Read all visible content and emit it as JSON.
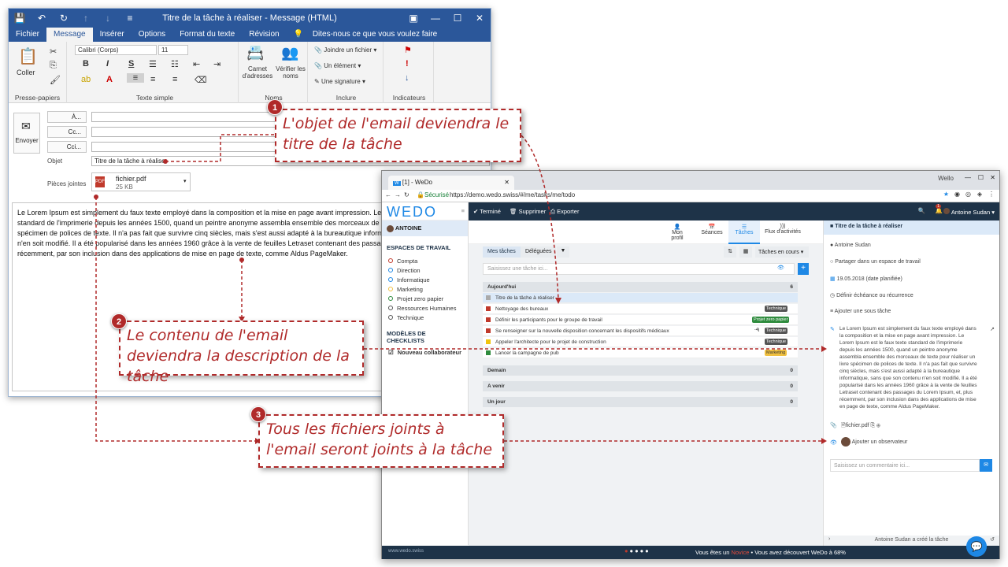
{
  "outlook": {
    "title": "Titre de la tâche à réaliser - Message (HTML)",
    "tabs": [
      "Fichier",
      "Message",
      "Insérer",
      "Options",
      "Format du texte",
      "Révision"
    ],
    "tell_me": "Dites-nous ce que vous voulez faire",
    "paste": "Coller",
    "clipboard": "Presse-papiers",
    "font": "Calibri (Corps)",
    "font_size": "11",
    "simple_text": "Texte simple",
    "address_book": "Carnet d'adresses",
    "check_names": "Vérifier les noms",
    "names": "Noms",
    "attach_file": "Joindre un fichier",
    "item": "Un élément",
    "signature": "Une signature",
    "include": "Inclure",
    "indicators": "Indicateurs",
    "send": "Envoyer",
    "to": "À...",
    "cc": "Cc...",
    "bcc": "Cci...",
    "subject_label": "Objet",
    "subject": "Titre de la tâche à réaliser",
    "attachments_label": "Pièces jointes",
    "attachment_name": "fichier.pdf",
    "attachment_size": "25 KB",
    "body": "Le Lorem Ipsum est simplement du faux texte employé dans la composition et la mise en page avant impression. Le Lorem Ipsum est le faux texte standard de l'imprimerie depuis les années 1500, quand un peintre anonyme assembla ensemble des morceaux de texte pour réaliser un livre spécimen de polices de texte. Il n'a pas fait que survivre cinq siècles, mais s'est aussi adapté à la bureautique informatique, sans que son contenu n'en soit modifié. Il a été popularisé dans les années 1960 grâce à la vente de feuilles Letraset contenant des passages du Lorem Ipsum, et, plus récemment, par son inclusion dans des applications de mise en page de texte, comme Aldus PageMaker."
  },
  "wedo": {
    "tab_title": "[1] - WeDo",
    "window_label": "Wello",
    "secure": "Sécurisé",
    "url": "https://demo.wedo.swiss/#/me/tasks/me/todo",
    "logo": "WEDO",
    "user": "ANTOINE",
    "toolbar": [
      "Terminé",
      "Supprimer",
      "Exporter"
    ],
    "top_user": "Antoine Sudan",
    "notif_count": "1",
    "nav": [
      "Mon profil",
      "Séances",
      "Tâches",
      "Flux d'activités"
    ],
    "spaces_title": "ESPACES DE TRAVAIL",
    "spaces": [
      "Compta",
      "Direction",
      "Informatique",
      "Marketing",
      "Projet zero papier",
      "Ressources Humaines",
      "Technique"
    ],
    "checklists_title": "MODÈLES DE CHECKLISTS",
    "checklist_item": "Nouveau collaborateur",
    "filter_my": "Mes tâches",
    "filter_delegated": "Déléguées",
    "filter_status": "Tâches en cours",
    "search_placeholder": "Saisissez une tâche ici...",
    "today": "Aujourd'hui",
    "today_count": "6",
    "tasks": [
      {
        "label": "Titre de la tâche à réaliser",
        "color": "#aaaaaa",
        "tag": "",
        "tag_color": ""
      },
      {
        "label": "Nettoyage des bureaux",
        "color": "#c0392b",
        "tag": "Technique",
        "tag_color": "#555555"
      },
      {
        "label": "Définir les participants pour le groupe de travail",
        "color": "#c0392b",
        "tag": "Projet zero papier",
        "tag_color": "#2e8b3d"
      },
      {
        "label": "Se renseigner sur la nouvelle disposition concernant les dispositifs médicaux",
        "color": "#c0392b",
        "tag": "Technique",
        "tag_color": "#555555"
      },
      {
        "label": "Appeler l'architecte pour le projet de construction",
        "color": "#f1c40f",
        "tag": "Technique",
        "tag_color": "#555555"
      },
      {
        "label": "Lancer la campagne de pub",
        "color": "#2e8b3d",
        "tag": "Marketing",
        "tag_color": "#f0c040"
      }
    ],
    "task4_extra": "-4j",
    "sections": [
      {
        "label": "Demain",
        "count": "0"
      },
      {
        "label": "A venir",
        "count": "0"
      },
      {
        "label": "Un jour",
        "count": "0"
      }
    ],
    "detail_title": "Titre de la tâche à réaliser",
    "detail_user": "Antoine Sudan",
    "detail_share": "Partager dans un espace de travail",
    "detail_date": "19.05.2018 (date planifiée)",
    "detail_due": "Définir échéance ou récurrence",
    "detail_subtask": "Ajouter une sous tâche",
    "detail_desc": "Le Lorem Ipsum est simplement du faux texte employé dans la composition et la mise en page avant impression. Le Lorem Ipsum est le faux texte standard de l'imprimerie depuis les années 1500, quand un peintre anonyme assembla ensemble des morceaux de texte pour réaliser un livre spécimen de polices de texte. Il n'a pas fait que survivre cinq siècles, mais s'est aussi adapté à la bureautique informatique, sans que son contenu n'en soit modifié. Il a été popularisé dans les années 1960 grâce à la vente de feuilles Letraset contenant des passages du Lorem Ipsum, et, plus récemment, par son inclusion dans des applications de mise en page de texte, comme Aldus PageMaker.",
    "detail_file": "fichier.pdf",
    "detail_observer": "Ajouter un observateur",
    "comment_placeholder": "Saisissez un commentaire ici...",
    "created_by": "Antoine Sudan a créé la tâche",
    "footer_brand": "www.wedo.swiss",
    "footer_text_a": "Vous êtes un",
    "footer_level": "Novice",
    "footer_text_b": "• Vous avez découvert WeDo à 68%"
  },
  "callouts": [
    {
      "num": "1",
      "text": "L'objet de l'email deviendra le titre de la tâche"
    },
    {
      "num": "2",
      "text": "Le contenu de l'email deviendra la description de la tâche"
    },
    {
      "num": "3",
      "text": "Tous les fichiers joints à l'email seront joints à la tâche"
    }
  ],
  "colors": {
    "outlook_blue": "#2b579a",
    "wedo_dark": "#1e3348",
    "wedo_accent": "#1e88e5",
    "callout_red": "#b02a2a"
  }
}
